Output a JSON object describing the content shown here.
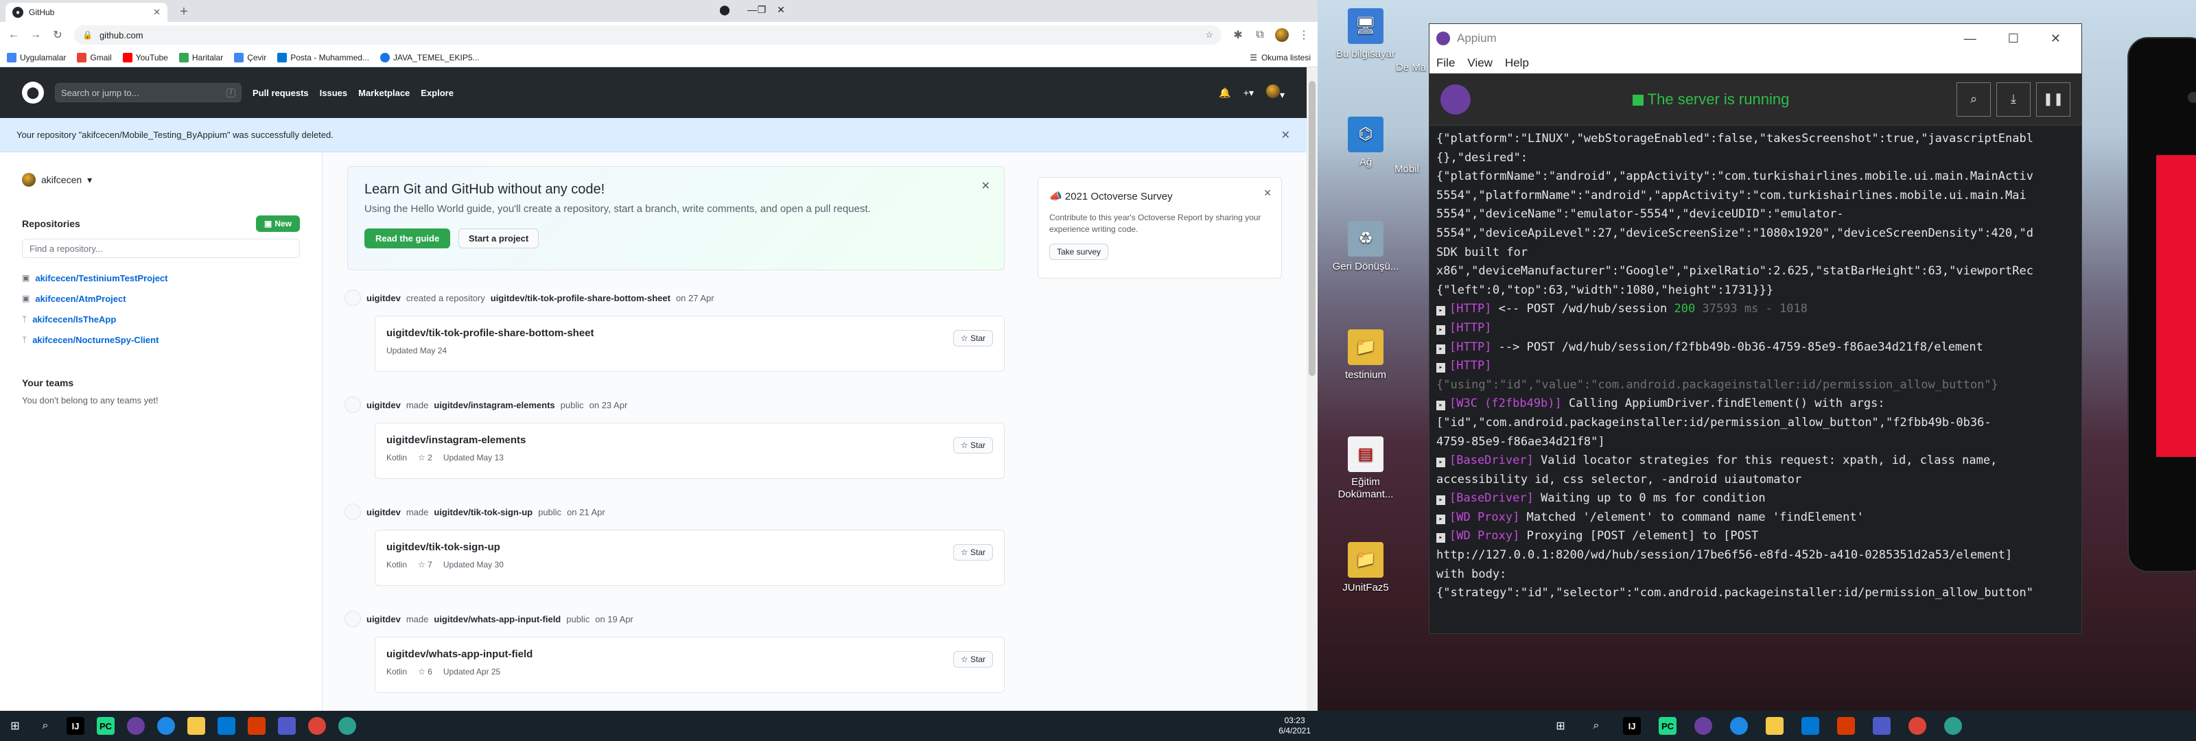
{
  "chrome": {
    "tab_title": "GitHub",
    "url": "github.com",
    "bookmarks": [
      "Uygulamalar",
      "Gmail",
      "YouTube",
      "Haritalar",
      "Çevir",
      "Posta - Muhammed...",
      "JAVA_TEMEL_EKIP5..."
    ],
    "reading_list": "Okuma listesi"
  },
  "github": {
    "search_placeholder": "Search or jump to...",
    "search_key": "/",
    "nav": [
      "Pull requests",
      "Issues",
      "Marketplace",
      "Explore"
    ],
    "flash": "Your repository \"akifcecen/Mobile_Testing_ByAppium\" was successfully deleted.",
    "account": "akifcecen",
    "repositories_heading": "Repositories",
    "new_button": "New",
    "find_placeholder": "Find a repository...",
    "repos": [
      "akifcecen/TestiniumTestProject",
      "akifcecen/AtmProject",
      "akifcecen/IsTheApp",
      "akifcecen/NocturneSpy-Client"
    ],
    "teams_heading": "Your teams",
    "teams_text": "You don't belong to any teams yet!",
    "learn_title": "Learn Git and GitHub without any code!",
    "learn_text": "Using the Hello World guide, you'll create a repository, start a branch, write comments, and open a pull request.",
    "read_guide": "Read the guide",
    "start_project": "Start a project",
    "survey_title": "2021 Octoverse Survey",
    "survey_text": "Contribute to this year's Octoverse Report by sharing your experience writing code.",
    "take_survey": "Take survey",
    "star_label": "Star",
    "feed": [
      {
        "actor": "uigitdev",
        "action": "created a repository",
        "target": "uigitdev/tik-tok-profile-share-bottom-sheet",
        "suffix": "",
        "date": "on 27 Apr",
        "repo": "uigitdev/tik-tok-profile-share-bottom-sheet",
        "lang": "",
        "stars": "",
        "updated": "Updated May 24"
      },
      {
        "actor": "uigitdev",
        "action": "made",
        "target": "uigitdev/instagram-elements",
        "suffix": "public",
        "date": "on 23 Apr",
        "repo": "uigitdev/instagram-elements",
        "lang": "Kotlin",
        "stars": "2",
        "updated": "Updated May 13"
      },
      {
        "actor": "uigitdev",
        "action": "made",
        "target": "uigitdev/tik-tok-sign-up",
        "suffix": "public",
        "date": "on 21 Apr",
        "repo": "uigitdev/tik-tok-sign-up",
        "lang": "Kotlin",
        "stars": "7",
        "updated": "Updated May 30"
      },
      {
        "actor": "uigitdev",
        "action": "made",
        "target": "uigitdev/whats-app-input-field",
        "suffix": "public",
        "date": "on 19 Apr",
        "repo": "uigitdev/whats-app-input-field",
        "lang": "Kotlin",
        "stars": "6",
        "updated": "Updated Apr 25"
      }
    ]
  },
  "taskbar_left": {
    "time": "03:23",
    "date": "6/4/2021"
  },
  "desktop": {
    "icons": [
      "Bu bilgisayar",
      "Ağ",
      "Geri Dönüşü...",
      "testinium",
      "Eğitim Dokümant...",
      "JUnitFaz5"
    ],
    "partial_icons": [
      "De Ma",
      "Mobil"
    ]
  },
  "appium": {
    "title": "Appium",
    "menu": [
      "File",
      "View",
      "Help"
    ],
    "status": "The server is running",
    "log": [
      {
        "tag": "",
        "text": "{\"platform\":\"LINUX\",\"webStorageEnabled\":false,\"takesScreenshot\":true,\"javascriptEnabl",
        "mark": false
      },
      {
        "tag": "",
        "text": "{},\"desired\":",
        "mark": false
      },
      {
        "tag": "",
        "text": "{\"platformName\":\"android\",\"appActivity\":\"com.turkishairlines.mobile.ui.main.MainActiv",
        "mark": false
      },
      {
        "tag": "",
        "text": "5554\",\"platformName\":\"android\",\"appActivity\":\"com.turkishairlines.mobile.ui.main.Mai",
        "mark": false
      },
      {
        "tag": "",
        "text": "5554\",\"deviceName\":\"emulator-5554\",\"deviceUDID\":\"emulator-",
        "mark": false
      },
      {
        "tag": "",
        "text": "5554\",\"deviceApiLevel\":27,\"deviceScreenSize\":\"1080x1920\",\"deviceScreenDensity\":420,\"d",
        "mark": false
      },
      {
        "tag": "",
        "text": "SDK built for",
        "mark": false
      },
      {
        "tag": "",
        "text": "x86\",\"deviceManufacturer\":\"Google\",\"pixelRatio\":2.625,\"statBarHeight\":63,\"viewportRec",
        "mark": false
      },
      {
        "tag": "",
        "text": "{\"left\":0,\"top\":63,\"width\":1080,\"height\":1731}}}",
        "mark": false
      },
      {
        "tag": "[HTTP]",
        "text": " <-- POST /wd/hub/session ",
        "ok": "200",
        "dim": " 37593 ms - 1018",
        "mark": true
      },
      {
        "tag": "[HTTP]",
        "text": "",
        "mark": true
      },
      {
        "tag": "[HTTP]",
        "text": " --> POST /wd/hub/session/f2fbb49b-0b36-4759-85e9-f86ae34d21f8/element",
        "mark": true
      },
      {
        "tag": "[HTTP]",
        "text": "",
        "mark": true
      },
      {
        "tag": "",
        "text": "",
        "dim": "{\"using\":\"id\",\"value\":\"com.android.packageinstaller:id/permission_allow_button\"}",
        "mark": false
      },
      {
        "tag": "[W3C (f2fbb49b)]",
        "text": " Calling AppiumDriver.findElement() with args:",
        "mark": true
      },
      {
        "tag": "",
        "text": "[\"id\",\"com.android.packageinstaller:id/permission_allow_button\",\"f2fbb49b-0b36-",
        "mark": false
      },
      {
        "tag": "",
        "text": "4759-85e9-f86ae34d21f8\"]",
        "mark": false
      },
      {
        "tag": "[BaseDriver]",
        "text": " Valid locator strategies for this request: xpath, id, class name,",
        "mark": true
      },
      {
        "tag": "",
        "text": "accessibility id, css selector, -android uiautomator",
        "mark": false
      },
      {
        "tag": "[BaseDriver]",
        "text": " Waiting up to 0 ms for condition",
        "mark": true
      },
      {
        "tag": "[WD Proxy]",
        "text": " Matched '/element' to command name 'findElement'",
        "mark": true
      },
      {
        "tag": "[WD Proxy]",
        "text": " Proxying [POST /element] to [POST",
        "mark": true
      },
      {
        "tag": "",
        "text": "http://127.0.0.1:8200/wd/hub/session/17be6f56-e8fd-452b-a410-0285351d2a53/element]",
        "mark": false
      },
      {
        "tag": "",
        "text": "with body:",
        "mark": false
      },
      {
        "tag": "",
        "text": "{\"strategy\":\"id\",\"selector\":\"com.android.packageinstaller:id/permission_allow_button\"",
        "mark": false
      }
    ]
  }
}
